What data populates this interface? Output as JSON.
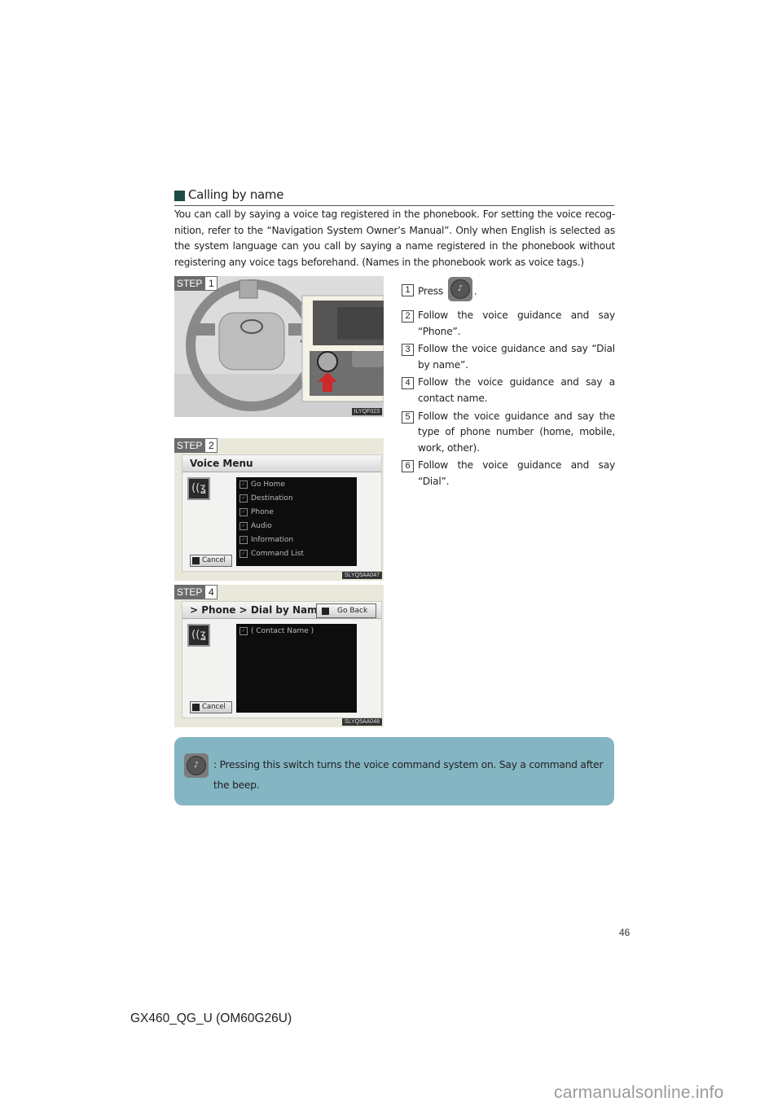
{
  "section": {
    "title": "Calling by name",
    "intro": "You can call by saying a voice tag registered in the phonebook. For setting the voice recog-nition, refer to the “Navigation System Owner’s Manual”. Only when English is selected as the system language can you call by saying a name registered in the phonebook without registering any voice tags beforehand. (Names in the phonebook work as voice tags.)"
  },
  "figures": [
    {
      "step_label": "STEP",
      "step_num": "1",
      "code": "ILYQF023",
      "description": "Steering wheel with talk switch highlighted by red arrow"
    },
    {
      "step_label": "STEP",
      "step_num": "2",
      "code": "SLYQ5AA047",
      "screen": {
        "title": "Voice Menu",
        "items": [
          "Go Home",
          "Destination",
          "Phone",
          "Audio",
          "Information",
          "Command List"
        ],
        "cancel": "Cancel"
      }
    },
    {
      "step_label": "STEP",
      "step_num": "4",
      "code": "SLYQ5AA048",
      "screen": {
        "breadcrumb": "> Phone > Dial by Name",
        "go_back": "Go Back",
        "items": [
          "( Contact Name )"
        ],
        "cancel": "Cancel"
      }
    }
  ],
  "steps": [
    {
      "num": "1",
      "pre": "Press",
      "post": "."
    },
    {
      "num": "2",
      "text": "Follow the voice guidance and say “Phone”."
    },
    {
      "num": "3",
      "text": "Follow the voice guidance and say “Dial by name”."
    },
    {
      "num": "4",
      "text": "Follow the voice guidance and say a contact name."
    },
    {
      "num": "5",
      "text": "Follow the voice guidance and say the type of phone number (home, mobile, work, other)."
    },
    {
      "num": "6",
      "text": "Follow the voice guidance and say “Dial”."
    }
  ],
  "note": {
    "icon": "talk-switch-icon",
    "text": ": Pressing this switch turns the voice command system on. Say a command after the beep."
  },
  "footer": {
    "page_number": "46",
    "doc_code": "GX460_QG_U (OM60G26U)",
    "watermark": "carmanualsonline.info"
  }
}
